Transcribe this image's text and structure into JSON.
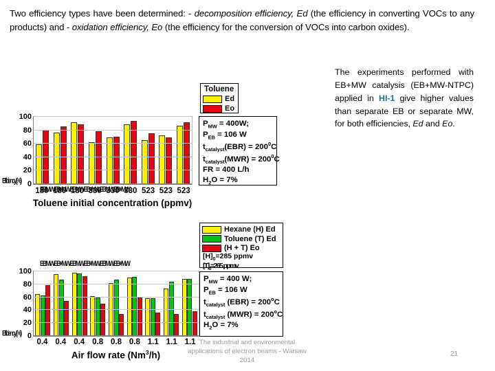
{
  "intro": {
    "seg1": "Two efficiency types have been determined: - ",
    "em1": "decomposition efficiency, Ed",
    "seg2": " (the efficiency in converting VOCs to any products) and - ",
    "em2": "oxidation efficiency, Eo",
    "seg3": " (the efficiency for the conversion of VOCs into carbon oxides)."
  },
  "side_note": {
    "seg1": "The experiments performed with EB+MW catalysis (EB+MW-NTPC) applied in ",
    "highlight": "HI-1",
    "seg2": " give higher values than separate EB or separate MW, for both efficiencies, ",
    "em1": "Ed",
    "seg3": " and ",
    "em2": "Eo",
    "seg4": "."
  },
  "colors": {
    "yellow": "#FFF200",
    "red": "#E30613",
    "green": "#00C516",
    "highlight": "#1f6f8f",
    "grid": "#c9c9c9",
    "axis": "#808080"
  },
  "chart1": {
    "legend": {
      "title": "Toluene",
      "entries": [
        {
          "label": "Ed",
          "color": "#FFF200"
        },
        {
          "label": "Eo",
          "color": "#E30613"
        }
      ]
    },
    "params": [
      "P_MW = 400W;",
      "P_EB = 106 W",
      "t_catalyst(EBR) = 200 °C",
      "t_catalyst(MWR) = 200 °C",
      "FR = 400 L/h",
      "H2O = 7%"
    ],
    "artifact_top": "EB MW EB+MW EB MW EB+MW EB MW EB+MW",
    "artifact_left": "Efficiency (%)",
    "chart_data": {
      "type": "bar",
      "title": "",
      "xlabel": "Toluene initial concentration (ppmv)",
      "ylabel": "",
      "ylim": [
        0,
        100
      ],
      "yticks": [
        0,
        20,
        40,
        60,
        80,
        100
      ],
      "grid": true,
      "legend_position": "top-right",
      "categories": [
        "180",
        "180",
        "180",
        "330",
        "330",
        "330",
        "523",
        "523",
        "523"
      ],
      "series": [
        {
          "name": "Toluene Ed",
          "color": "#FFF200",
          "values": [
            59,
            77,
            92,
            62,
            69,
            89,
            65,
            72,
            87
          ]
        },
        {
          "name": "Toluene Eo",
          "color": "#E30613",
          "values": [
            81,
            86,
            89,
            79,
            70,
            94,
            76,
            69,
            92
          ]
        }
      ]
    }
  },
  "chart2": {
    "legend": {
      "entries": [
        {
          "label": "Hexane (H) Ed",
          "color": "#FFF200"
        },
        {
          "label": "Toluene (T) Ed",
          "color": "#00C516"
        },
        {
          "label": "(H + T) Eo",
          "color": "#E30613"
        }
      ],
      "notes": [
        "[H]0=285 ppmv",
        "[T]0=265 ppmv"
      ]
    },
    "params": [
      "P_MW = 400 W;",
      "P_EB = 106 W",
      "t_catalyst (EBR) = 200 °C",
      "t_catalyst (MWR) = 200 °C",
      "H2O = 7%"
    ],
    "artifact_top": "EB MW EB+MW EB MW EB+MW EB MW EB+MW",
    "artifact_left": "Efficiency (%)",
    "chart_data": {
      "type": "bar",
      "title": "",
      "xlabel": "Air flow rate (Nm3/h)",
      "ylabel": "",
      "ylim": [
        0,
        100
      ],
      "yticks": [
        0,
        20,
        40,
        60,
        80,
        100
      ],
      "grid": true,
      "legend_position": "top-right",
      "categories": [
        "0.4",
        "0.4",
        "0.4",
        "0.8",
        "0.8",
        "0.8",
        "1.1",
        "1.1",
        "1.1"
      ],
      "series": [
        {
          "name": "Hexane (H) Ed",
          "color": "#FFF200",
          "values": [
            65,
            96,
            98,
            62,
            82,
            90,
            59,
            73,
            88
          ]
        },
        {
          "name": "Toluene (T) Ed",
          "color": "#00C516",
          "values": [
            63,
            87,
            97,
            60,
            87,
            92,
            58,
            84,
            88
          ]
        },
        {
          "name": "(H + T) Eo",
          "color": "#E30613",
          "values": [
            79,
            54,
            93,
            50,
            34,
            60,
            36,
            34,
            38
          ]
        }
      ]
    }
  },
  "footer": {
    "line1": "The industrial and environmental",
    "line2": "applications of electron beams - Warsaw",
    "line3": "2014",
    "page_number": "21"
  }
}
